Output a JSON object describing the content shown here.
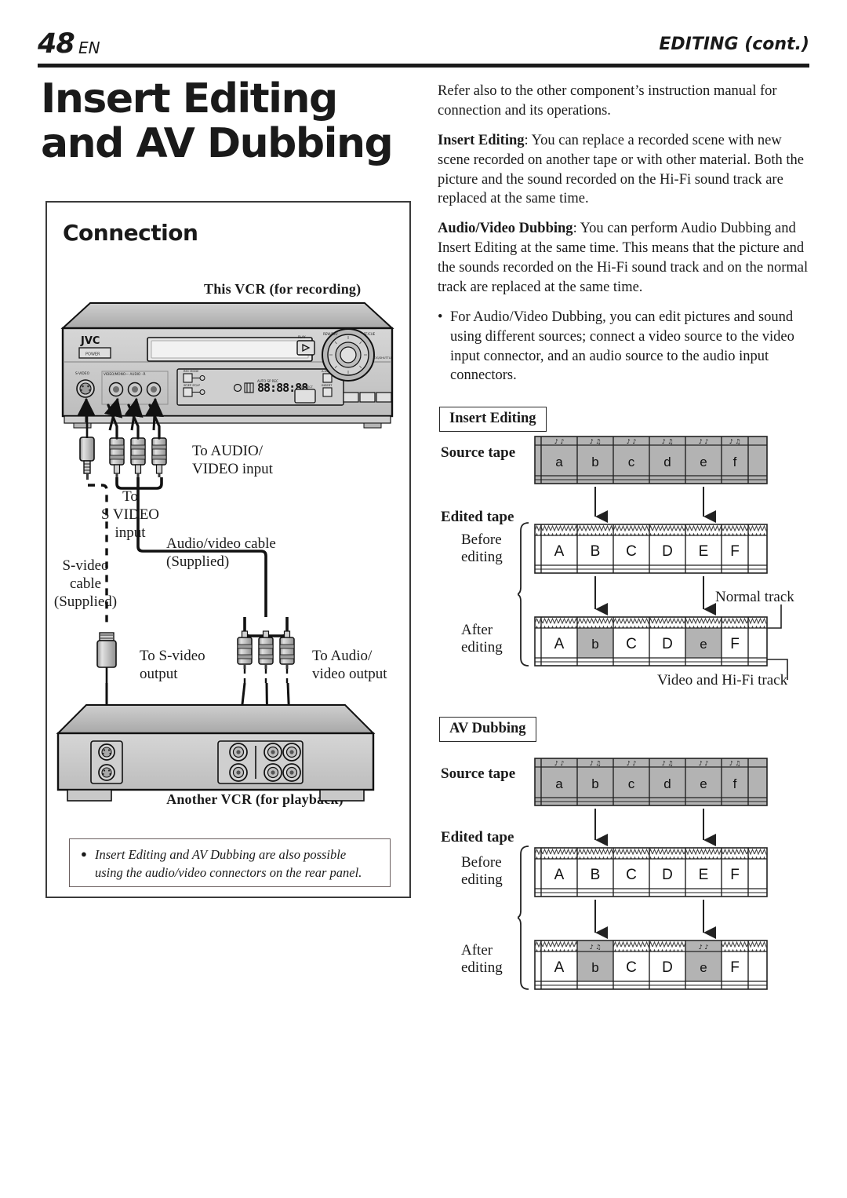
{
  "header": {
    "page_number": "48",
    "page_locale": "EN",
    "running_head": "EDITING (cont.)"
  },
  "title": {
    "line1": "Insert Editing",
    "line2": "and AV Dubbing"
  },
  "connection": {
    "heading": "Connection",
    "top_caption": "This VCR (for recording)",
    "bottom_caption": "Another VCR (for playback)",
    "labels": {
      "to_audio_video_input": "To AUDIO/\nVIDEO input",
      "to_audio_video_input_l1": "To AUDIO/",
      "to_audio_video_input_l2": "VIDEO input",
      "to_s_video_input_l1": "To",
      "to_s_video_input_l2": "S VIDEO",
      "to_s_video_input_l3": "input",
      "s_video_cable_l1": "S-video",
      "s_video_cable_l2": "cable",
      "s_video_cable_l3": "(Supplied)",
      "av_cable_l1": "Audio/video cable",
      "av_cable_l2": "(Supplied)",
      "to_s_video_output_l1": "To S-video",
      "to_s_video_output_l2": "output",
      "to_audio_video_output_l1": "To Audio/",
      "to_audio_video_output_l2": "video output"
    },
    "vcr_panel": {
      "brand": "JVC",
      "power_label": "POWER",
      "s_video_jack_label": "S-VIDEO",
      "av_jacks_label": "VIDEO/MONO AUDIO R",
      "play_label": "PLAY",
      "display_value": "88:88:88"
    },
    "note": {
      "bullet": "●",
      "line1": "Insert Editing and AV Dubbing are also possible",
      "line2": "using the audio/video connectors on the rear panel."
    }
  },
  "body": {
    "p1": "Refer also to the other component’s instruction manual for connection and its operations.",
    "p2_label": "Insert Editing",
    "p2": ": You can replace a recorded scene with new scene recorded on another tape or with other material. Both the picture and the sound recorded on the Hi-Fi sound track are replaced at the same time.",
    "p3_label": "Audio/Video Dubbing",
    "p3": ": You can perform Audio Dubbing and Insert Editing at the same time. This means that the picture and the sounds recorded on the Hi-Fi sound track and on the normal track are replaced at the same time.",
    "p4_bullet": "•",
    "p4": "For Audio/Video Dubbing, you can edit pictures and sound using different sources; connect a video source to the video input connector, and an audio source to the audio input connectors."
  },
  "diagrams": [
    {
      "id": "insert-editing",
      "tag": "Insert Editing",
      "source_tape_label": "Source tape",
      "edited_tape_label": "Edited tape",
      "before_label_l1": "Before",
      "before_label_l2": "editing",
      "after_label_l1": "After",
      "after_label_l2": "editing",
      "source_cells": [
        "a",
        "b",
        "c",
        "d",
        "e",
        "f"
      ],
      "before_cells": [
        "A",
        "B",
        "C",
        "D",
        "E",
        "F"
      ],
      "after_cells": [
        "A",
        "b",
        "C",
        "D",
        "e",
        "F"
      ],
      "after_highlight_indices": [
        1,
        4
      ],
      "after_top_track_music_indices": [],
      "callout_normal_track": "Normal track",
      "callout_video_hifi_track": "Video and Hi-Fi track",
      "arrow_from_indices": [
        1,
        4
      ]
    },
    {
      "id": "av-dubbing",
      "tag": "AV Dubbing",
      "source_tape_label": "Source tape",
      "edited_tape_label": "Edited tape",
      "before_label_l1": "Before",
      "before_label_l2": "editing",
      "after_label_l1": "After",
      "after_label_l2": "editing",
      "source_cells": [
        "a",
        "b",
        "c",
        "d",
        "e",
        "f"
      ],
      "before_cells": [
        "A",
        "B",
        "C",
        "D",
        "E",
        "F"
      ],
      "after_cells": [
        "A",
        "b",
        "C",
        "D",
        "e",
        "F"
      ],
      "after_highlight_indices": [
        1,
        4
      ],
      "after_top_track_music_indices": [
        1,
        4
      ],
      "callout_normal_track": "",
      "callout_video_hifi_track": "",
      "arrow_from_indices": [
        1,
        4
      ]
    }
  ],
  "colors": {
    "ink": "#1a1a1a",
    "tape_gray": "#b3b3b3",
    "panel_gray": "#bfbfbf",
    "panel_light": "#d9d9d9",
    "panel_dark": "#8c8c8c",
    "note_border": "#6b5f5f"
  }
}
